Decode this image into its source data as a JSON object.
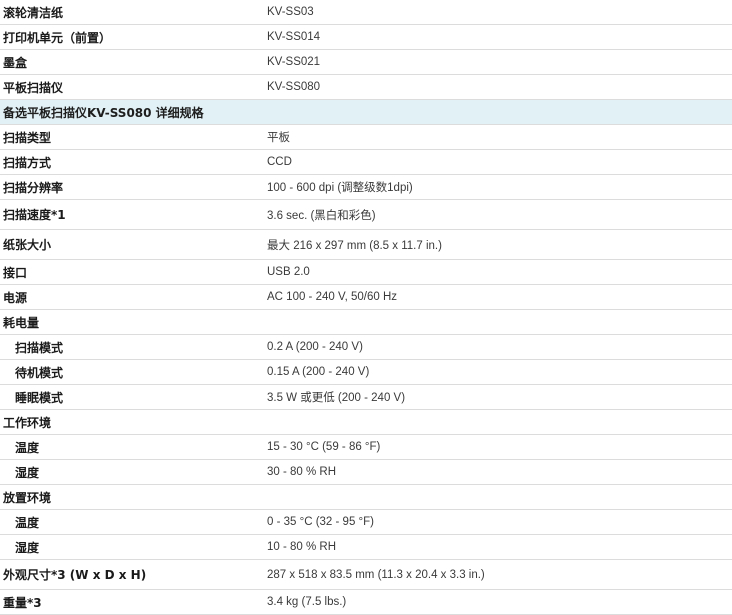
{
  "rows": [
    {
      "label": "滚轮清洁纸",
      "value": "KV-SS03"
    },
    {
      "label": "打印机单元（前置）",
      "value": "KV-SS014"
    },
    {
      "label": "墨盒",
      "value": "KV-SS021"
    },
    {
      "label": "平板扫描仪",
      "value": "KV-SS080"
    },
    {
      "label": "备选平板扫描仪KV-SS080 详细规格",
      "value": ""
    },
    {
      "label": "扫描类型",
      "value": "平板"
    },
    {
      "label": "扫描方式",
      "value": "CCD"
    },
    {
      "label": "扫描分辨率",
      "value": "100 - 600 dpi (调整级数1dpi)"
    },
    {
      "label": "扫描速度*1",
      "value": "3.6 sec. (黑白和彩色)"
    },
    {
      "label": "纸张大小",
      "value": "最大 216 x 297 mm (8.5 x 11.7 in.)"
    },
    {
      "label": "接口",
      "value": "USB 2.0"
    },
    {
      "label": "电源",
      "value": "AC 100 - 240 V, 50/60 Hz"
    },
    {
      "label": "耗电量",
      "value": ""
    },
    {
      "label": "扫描模式",
      "value": "0.2 A (200 - 240 V)"
    },
    {
      "label": "待机模式",
      "value": "0.15 A (200 - 240 V)"
    },
    {
      "label": "睡眠模式",
      "value": "3.5 W 或更低 (200 - 240 V)"
    },
    {
      "label": "工作环境",
      "value": ""
    },
    {
      "label": "温度",
      "value": "15 - 30 °C (59 - 86 °F)"
    },
    {
      "label": "湿度",
      "value": "30 - 80 % RH"
    },
    {
      "label": "放置环境",
      "value": ""
    },
    {
      "label": "温度",
      "value": "0 - 35 °C (32 - 95 °F)"
    },
    {
      "label": "湿度",
      "value": "10 - 80 % RH"
    },
    {
      "label": "外观尺寸*3 (W x D x H)",
      "value": "287 x 518 x 83.5 mm (11.3 x 20.4 x 3.3 in.)"
    },
    {
      "label": "重量*3",
      "value": "3.4 kg (7.5 lbs.)"
    }
  ]
}
